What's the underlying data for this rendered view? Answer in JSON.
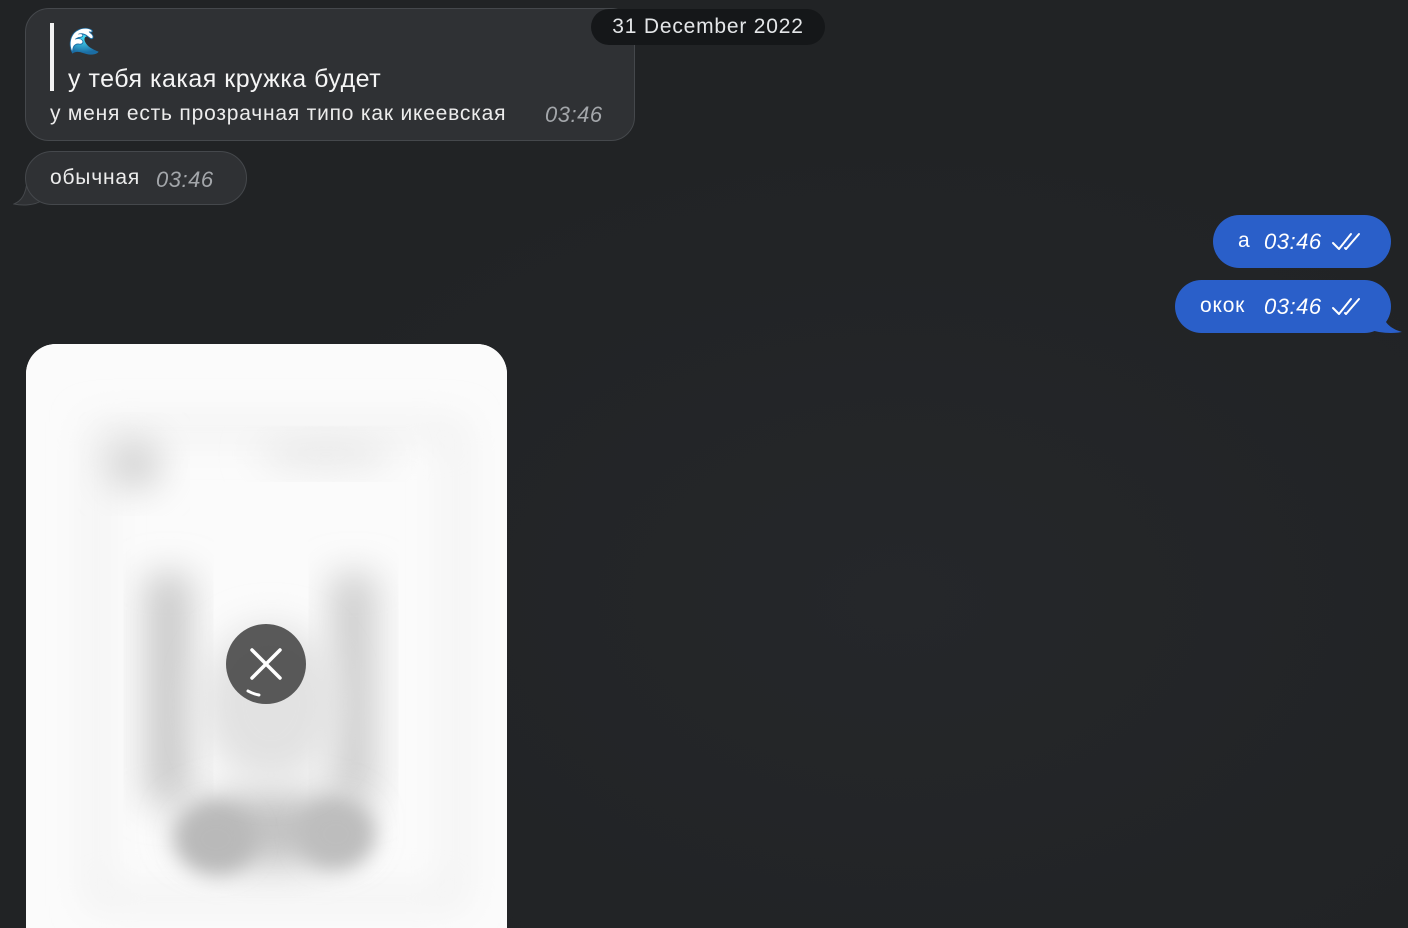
{
  "date_separator": "31 December 2022",
  "messages": {
    "reply": {
      "quote_emoji": "🌊",
      "quote_emoji_icon": "wave-emoji-icon",
      "quote_text": "у тебя какая кружка будет",
      "text": "у меня есть прозрачная типо как икеевская",
      "time": "03:46"
    },
    "incoming_plain": {
      "text": "обычная",
      "time": "03:46"
    },
    "outgoing": [
      {
        "text": "а",
        "time": "03:46",
        "status_icon": "double-check-icon"
      },
      {
        "text": "окок",
        "time": "03:46",
        "status_icon": "double-check-icon"
      }
    ],
    "image": {
      "state": "loading",
      "cancel_icon": "close-icon"
    }
  },
  "colors": {
    "background": "#212325",
    "incoming_bubble": "#2f3134",
    "outgoing_bubble": "#2a5fc9",
    "date_pill": "#151719"
  }
}
